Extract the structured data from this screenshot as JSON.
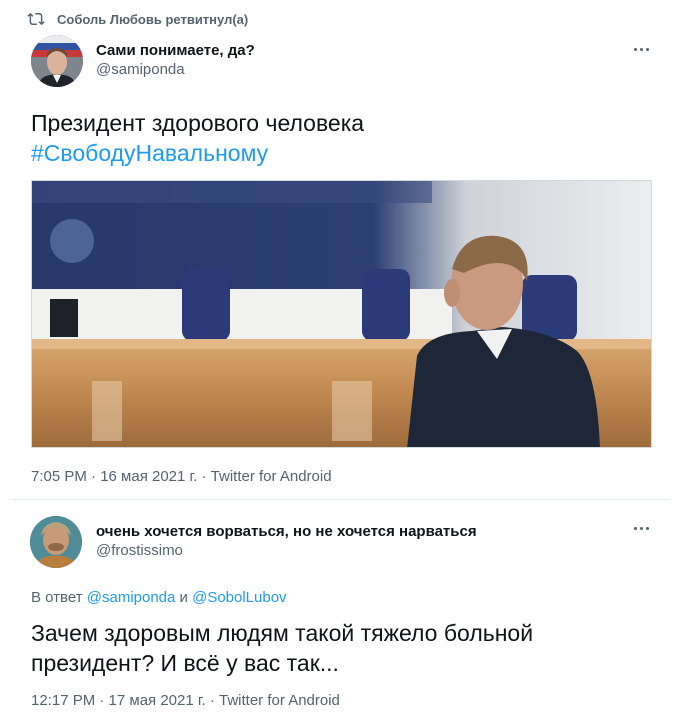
{
  "retweet": {
    "label": "Соболь Любовь ретвитнул(а)"
  },
  "tweet1": {
    "display_name": "Сами понимаете, да?",
    "handle": "@samiponda",
    "text_line1": "Президент здорового человека",
    "hashtag": "#СвободуНавальному",
    "meta": "7:05 PM · 16 мая 2021 г. · Twitter for Android"
  },
  "tweet2": {
    "display_name": "очень хочется ворваться, но не хочется нарваться",
    "handle": "@frostissimo",
    "reply_prefix": "В ответ",
    "reply_mention1": "@samiponda",
    "reply_and": "и",
    "reply_mention2": "@SobolLubov",
    "text_line1": "Зачем здоровым людям такой тяжело больной",
    "text_line2": "президент? И всё у вас так...",
    "meta": "12:17 PM · 17 мая 2021 г. · Twitter for Android"
  },
  "colors": {
    "link": "#1d9bf0",
    "secondary_text": "#536471",
    "primary_text": "#0f1419",
    "divider": "#e6ecf0"
  }
}
